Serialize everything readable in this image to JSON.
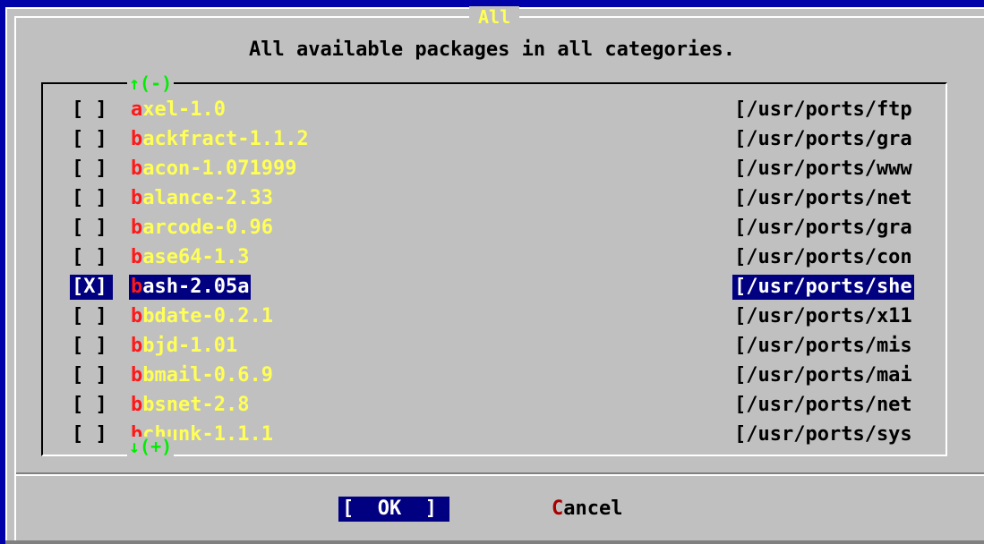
{
  "dialog": {
    "title": "All",
    "subtitle": "All available packages in all categories."
  },
  "scroll": {
    "up_label": "↑(-)",
    "down_label": "↓(+)"
  },
  "packages": [
    {
      "checkbox": "[ ]",
      "first": "a",
      "rest": "xel-1.0",
      "path": "[/usr/ports/ftp"
    },
    {
      "checkbox": "[ ]",
      "first": "b",
      "rest": "ackfract-1.1.2",
      "path": "[/usr/ports/gra"
    },
    {
      "checkbox": "[ ]",
      "first": "b",
      "rest": "acon-1.071999",
      "path": "[/usr/ports/www"
    },
    {
      "checkbox": "[ ]",
      "first": "b",
      "rest": "alance-2.33",
      "path": "[/usr/ports/net"
    },
    {
      "checkbox": "[ ]",
      "first": "b",
      "rest": "arcode-0.96",
      "path": "[/usr/ports/gra"
    },
    {
      "checkbox": "[ ]",
      "first": "b",
      "rest": "ase64-1.3",
      "path": "[/usr/ports/con"
    },
    {
      "checkbox": "[X]",
      "first": "b",
      "rest": "ash-2.05a",
      "path": "[/usr/ports/she"
    },
    {
      "checkbox": "[ ]",
      "first": "b",
      "rest": "bdate-0.2.1",
      "path": "[/usr/ports/x11"
    },
    {
      "checkbox": "[ ]",
      "first": "b",
      "rest": "bjd-1.01",
      "path": "[/usr/ports/mis"
    },
    {
      "checkbox": "[ ]",
      "first": "b",
      "rest": "bmail-0.6.9",
      "path": "[/usr/ports/mai"
    },
    {
      "checkbox": "[ ]",
      "first": "b",
      "rest": "bsnet-2.8",
      "path": "[/usr/ports/net"
    },
    {
      "checkbox": "[ ]",
      "first": "b",
      "rest": "chunk-1.1.1",
      "path": "[/usr/ports/sys"
    }
  ],
  "buttons": {
    "ok_label": "[  OK  ]",
    "cancel_hot": "C",
    "cancel_rest": "ancel"
  },
  "colors": {
    "screen_bg": "#0000a8",
    "dialog_bg": "#c0c0c0",
    "title": "#ffff55",
    "hotkey": "#ff1818",
    "package_name": "#ffff55",
    "selection_bg": "#000080",
    "scroll_indicator": "#00ee00"
  }
}
